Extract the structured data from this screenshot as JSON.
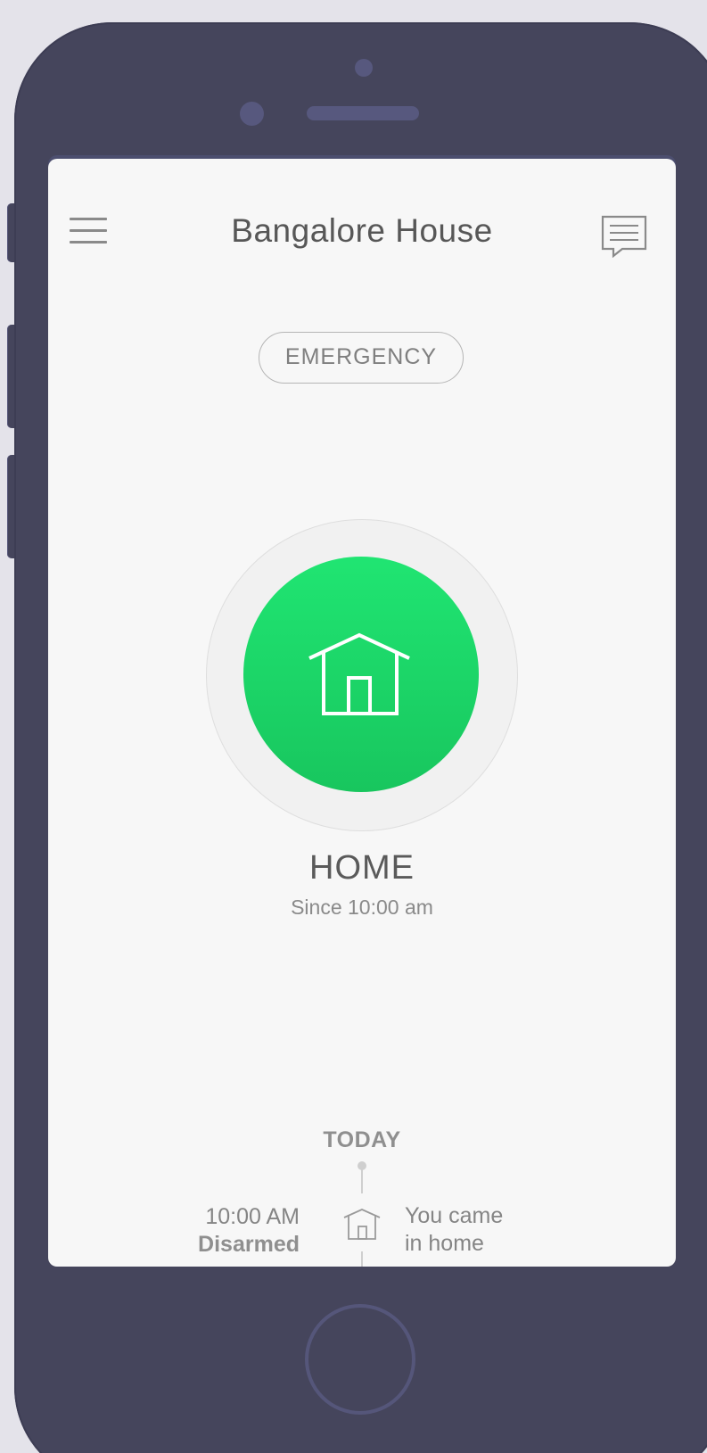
{
  "header": {
    "title": "Bangalore House"
  },
  "emergency": {
    "label": "EMERGENCY"
  },
  "mode": {
    "label": "HOME",
    "since": "Since 10:00 am",
    "color": "#1fd466"
  },
  "timeline": {
    "section_label": "TODAY",
    "events": [
      {
        "time": "10:00 AM",
        "status": "Disarmed",
        "icon": "house-icon",
        "description_line1": "You came",
        "description_line2": "in home"
      }
    ]
  },
  "icons": {
    "menu": "hamburger-menu-icon",
    "chat": "chat-bubble-icon",
    "mode": "house-icon"
  }
}
